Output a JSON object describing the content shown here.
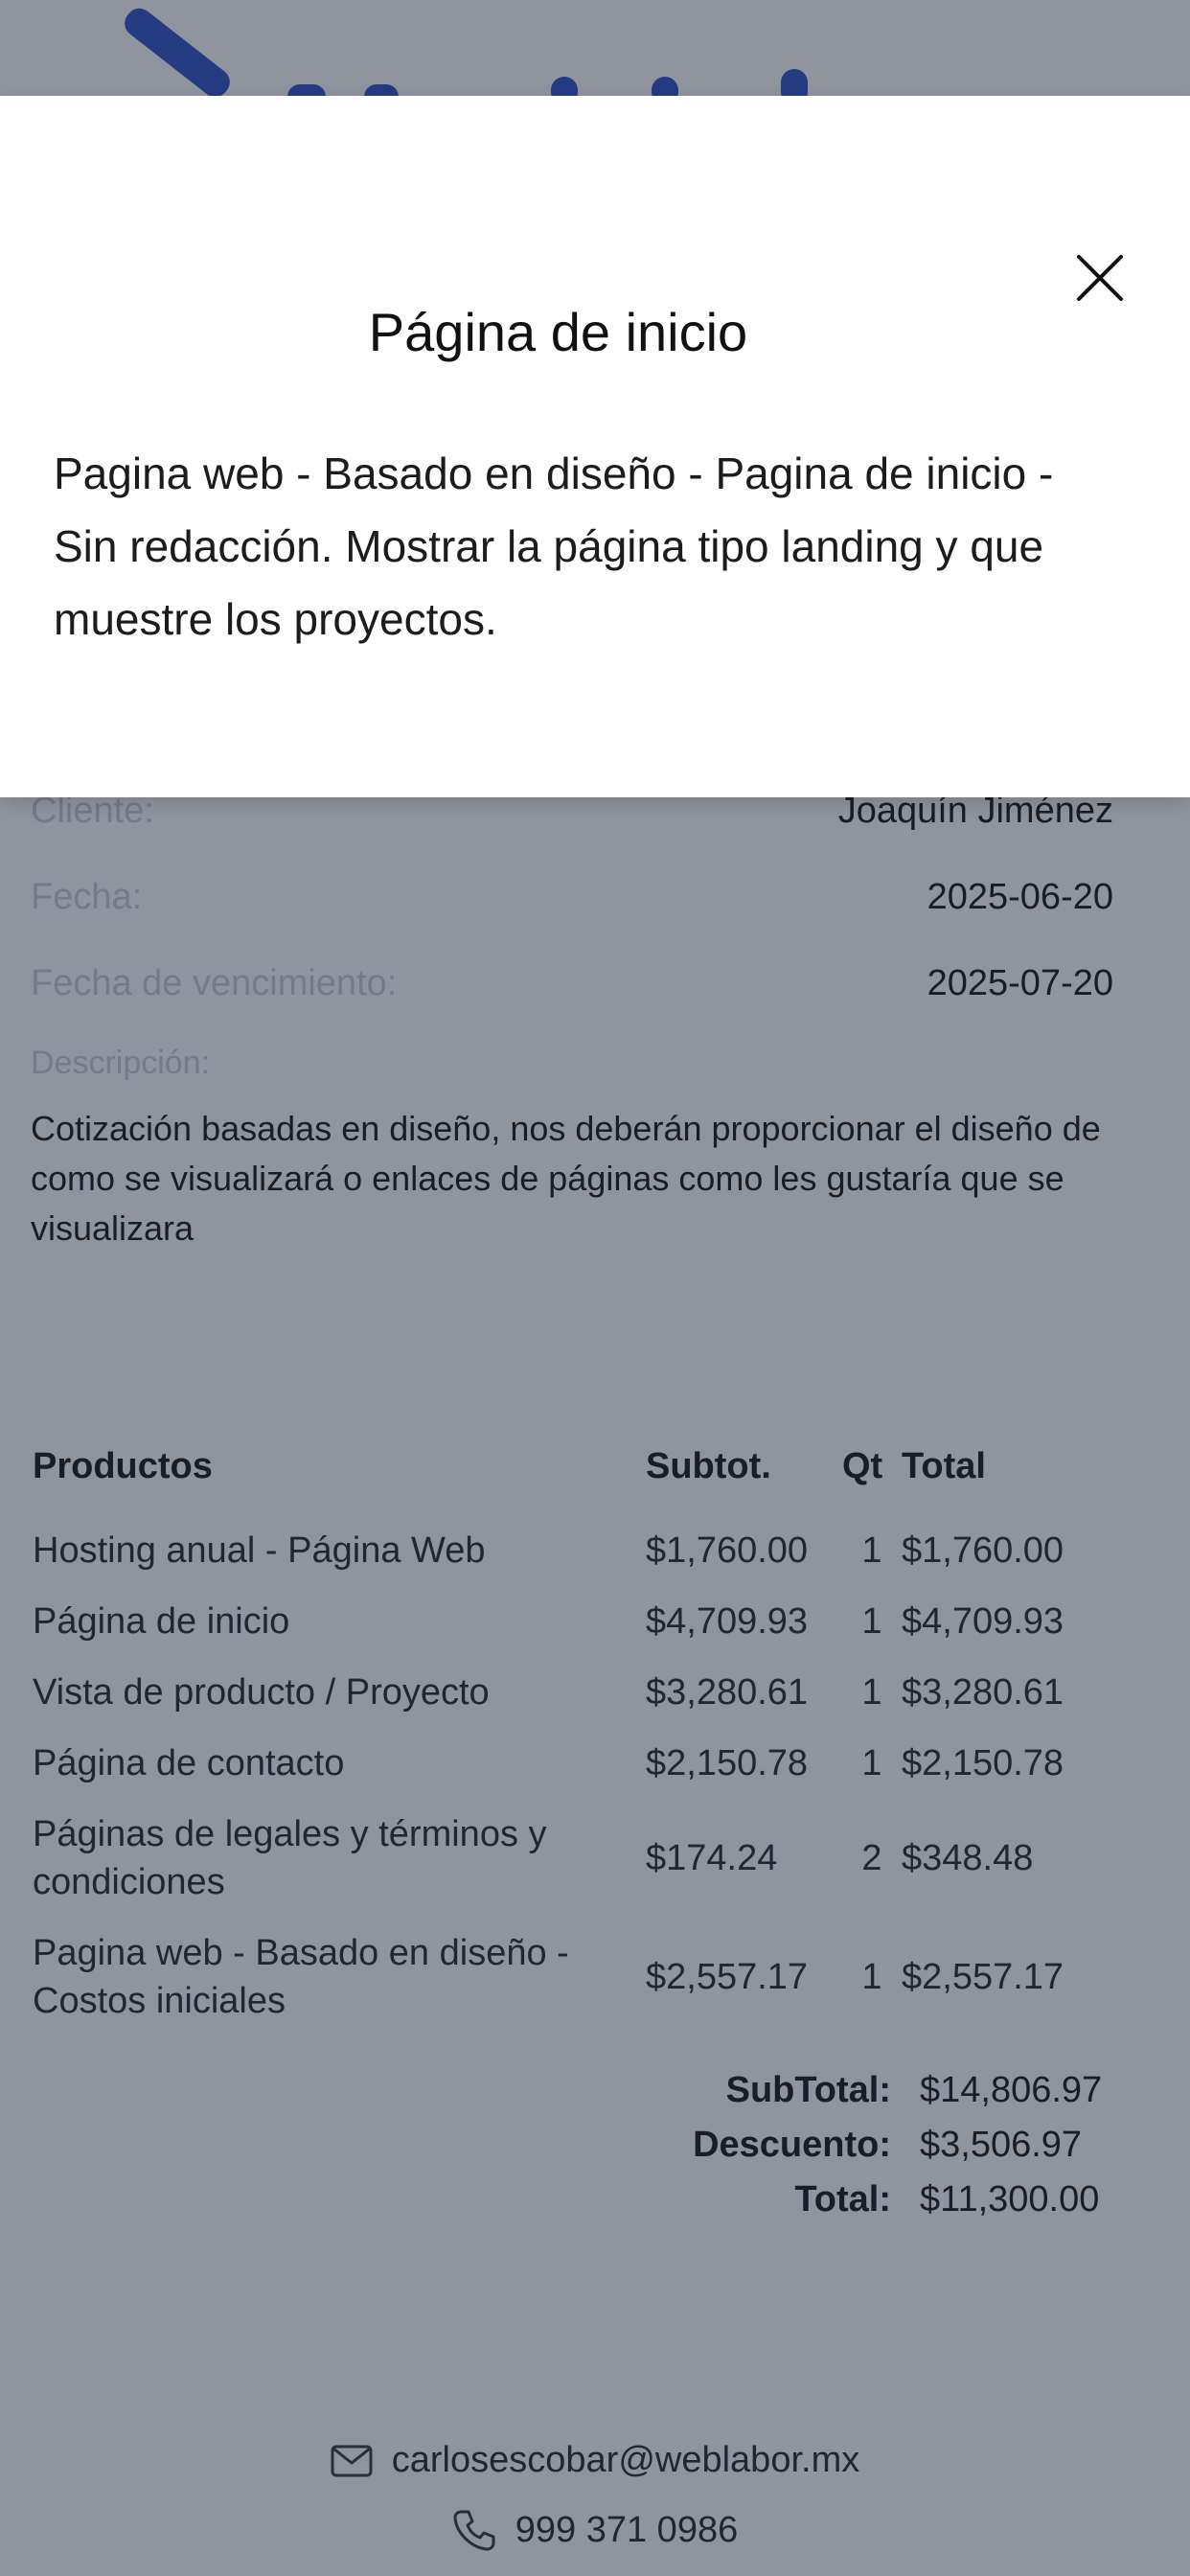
{
  "modal": {
    "title": "Página de inicio",
    "description": "Pagina web - Basado en diseño - Pagina de inicio - Sin redacción. Mostrar la página tipo landing y que muestre los proyectos.",
    "close_icon": "close-icon"
  },
  "quote": {
    "client_label": "Cliente:",
    "client_value": "Joaquín Jiménez",
    "date_label": "Fecha:",
    "date_value": "2025-06-20",
    "due_label": "Fecha de vencimiento:",
    "due_value": "2025-07-20",
    "description_label": "Descripción:",
    "description_text": "Cotización basadas en diseño, nos deberán proporcionar el diseño de como se visualizará o enlaces de páginas como les gustaría que se visualizara"
  },
  "products": {
    "headers": {
      "name": "Productos",
      "subtotal": "Subtot.",
      "qty": "Qt",
      "total": "Total"
    },
    "rows": [
      {
        "name": "Hosting anual - Página Web",
        "subtotal": "$1,760.00",
        "qty": "1",
        "total": "$1,760.00"
      },
      {
        "name": "Página de inicio",
        "subtotal": "$4,709.93",
        "qty": "1",
        "total": "$4,709.93"
      },
      {
        "name": "Vista de producto / Proyecto",
        "subtotal": "$3,280.61",
        "qty": "1",
        "total": "$3,280.61"
      },
      {
        "name": "Página de contacto",
        "subtotal": "$2,150.78",
        "qty": "1",
        "total": "$2,150.78"
      },
      {
        "name": "Páginas de legales y términos y condiciones",
        "subtotal": "$174.24",
        "qty": "2",
        "total": "$348.48"
      },
      {
        "name": "Pagina web - Basado en diseño - Costos iniciales",
        "subtotal": "$2,557.17",
        "qty": "1",
        "total": "$2,557.17"
      }
    ]
  },
  "totals": {
    "subtotal_label": "SubTotal:",
    "subtotal_value": "$14,806.97",
    "discount_label": "Descuento:",
    "discount_value": "$3,506.97",
    "total_label": "Total:",
    "total_value": "$11,300.00"
  },
  "contact": {
    "email": "carlosescobar@weblabor.mx",
    "phone": "999 371 0986",
    "email_icon": "mail-icon",
    "phone_icon": "phone-icon"
  },
  "colors": {
    "accent": "#2a4cc4",
    "overlay": "#1f2940",
    "modal_bg": "#ffffff"
  }
}
